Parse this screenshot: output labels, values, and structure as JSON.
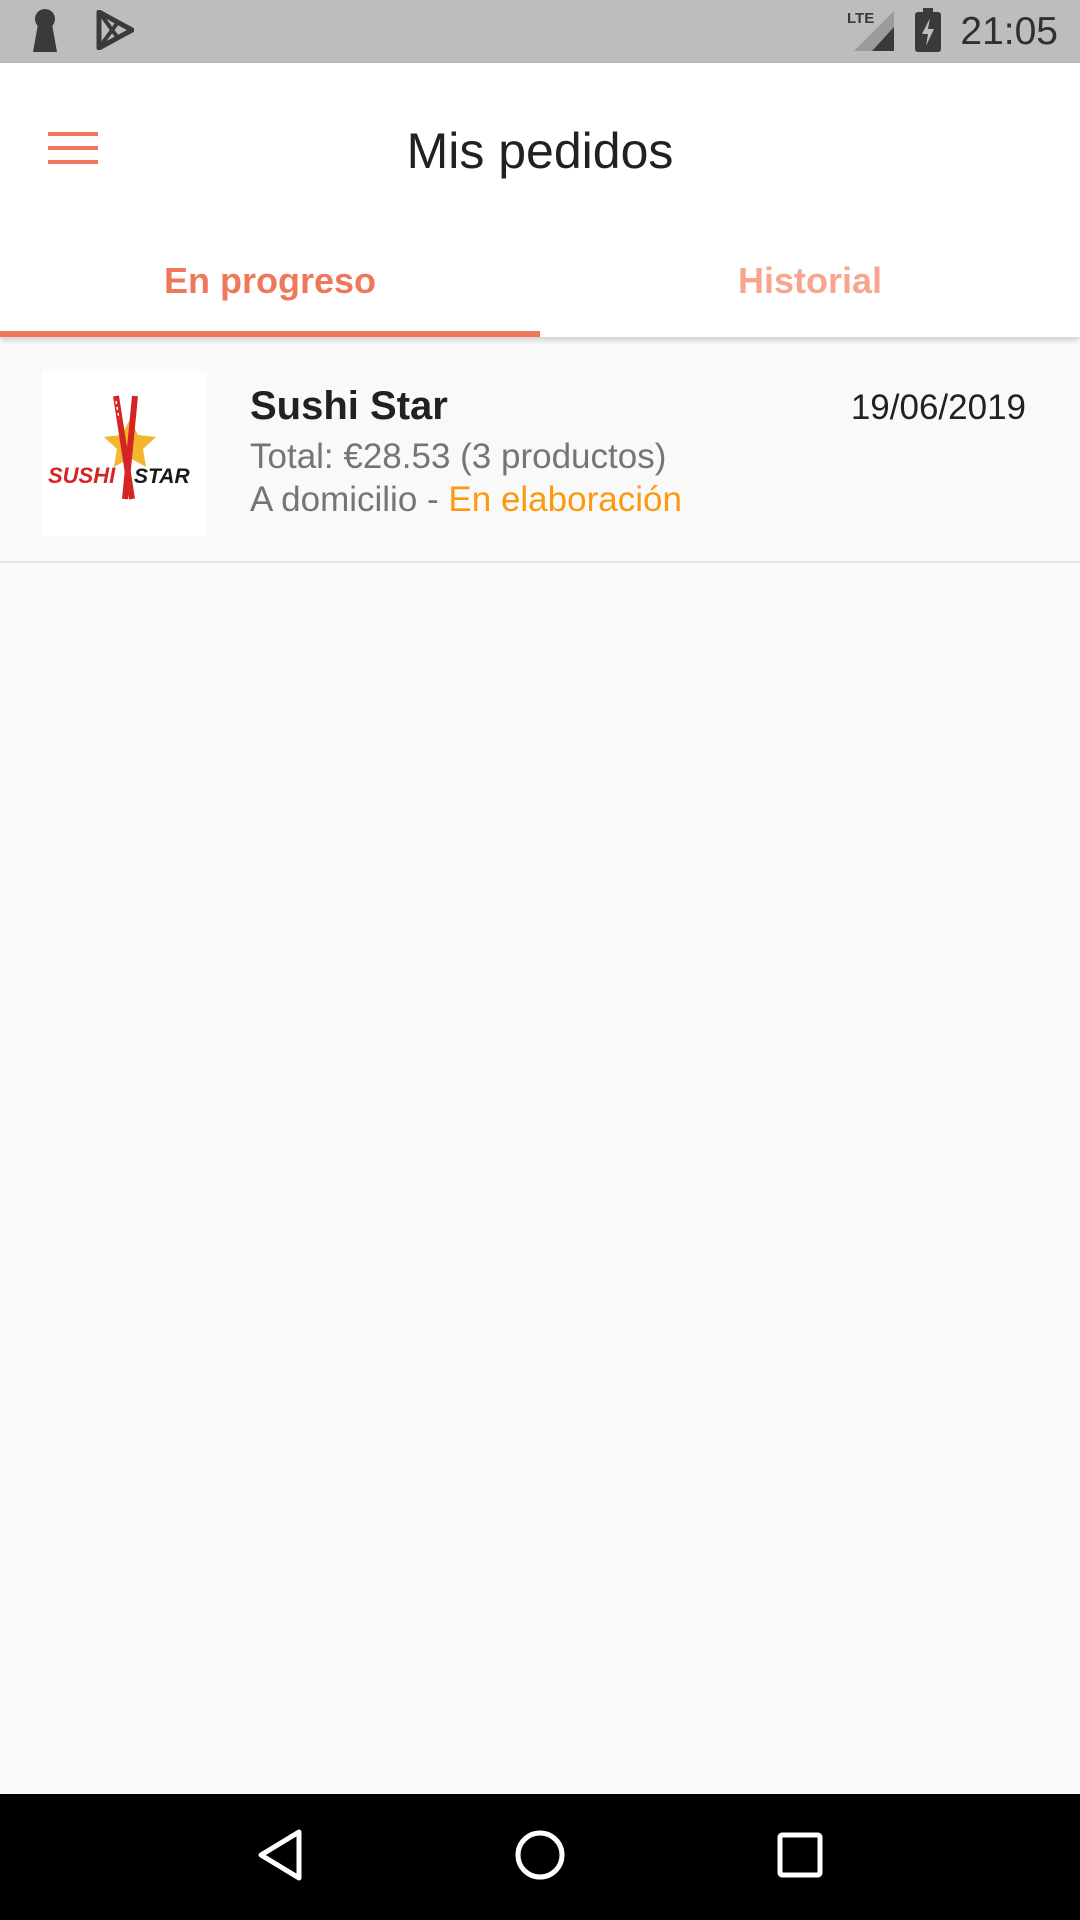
{
  "status_bar": {
    "time": "21:05",
    "network": "LTE",
    "icons": [
      "keyhole-icon",
      "play-store-icon",
      "lte-signal-icon",
      "battery-charging-icon"
    ]
  },
  "app_bar": {
    "title": "Mis pedidos",
    "menu_icon": "hamburger-menu-icon"
  },
  "tabs": [
    {
      "label": "En progreso",
      "selected": true
    },
    {
      "label": "Historial",
      "selected": false
    }
  ],
  "orders": [
    {
      "restaurant": "Sushi Star",
      "date": "19/06/2019",
      "total": "Total: €28.53 (3 productos)",
      "delivery": "A domicilio - ",
      "status": "En elaboración",
      "logo": {
        "icon": "sushi-star-logo",
        "text_left": "SUSHI",
        "text_right": "STAR"
      }
    }
  ],
  "nav_bar": {
    "icons": [
      "back-icon",
      "home-icon",
      "recents-icon"
    ]
  },
  "colors": {
    "accent": "#f0785a",
    "accent_light": "#f7a58e",
    "status_orange": "#fb9a10",
    "status_bar_bg": "#bdbdbd",
    "background": "#f9f9f9"
  }
}
